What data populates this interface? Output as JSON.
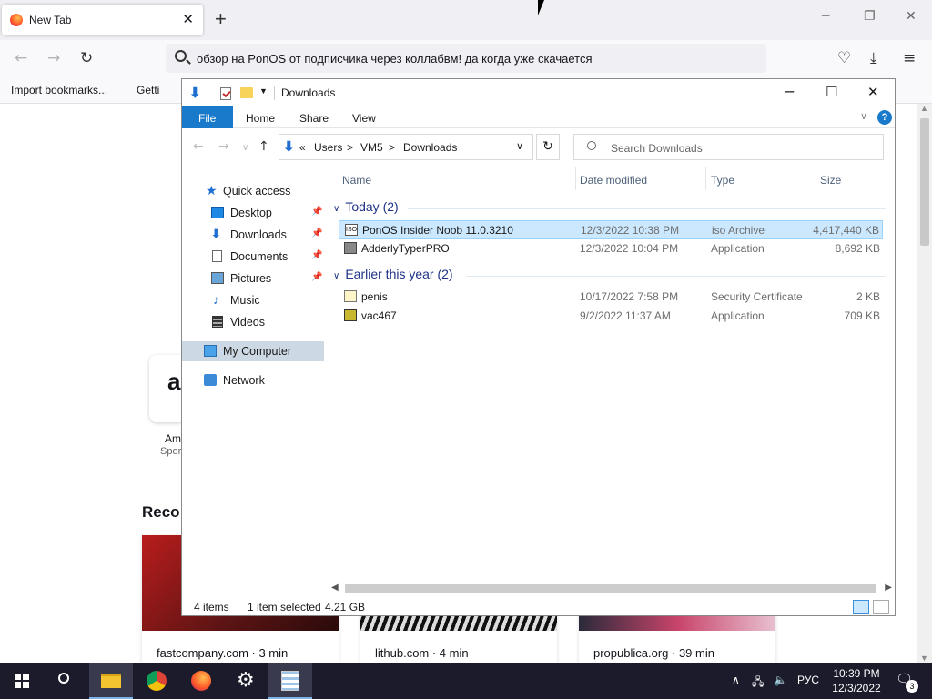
{
  "browser": {
    "tab_title": "New Tab",
    "new_tab": "+",
    "win_min": "─",
    "win_max": "❐",
    "win_close": "✕",
    "back": "←",
    "forward": "→",
    "reload": "↻",
    "url": "обзор на PonOS от подписчика через коллабвм! да когда уже скачается",
    "bookmarks": [
      "Import bookmarks...",
      "Getti"
    ],
    "amazon_title": "Am",
    "amazon_sub": "Spor",
    "recent_heading": "Reco",
    "recent_cards": [
      {
        "source": "fastcompany.com · 3 min"
      },
      {
        "source": "lithub.com · 4 min"
      },
      {
        "source": "propublica.org · 39 min"
      }
    ]
  },
  "explorer": {
    "title": "Downloads",
    "ribbon_tabs": [
      "File",
      "Home",
      "Share",
      "View"
    ],
    "help": "?",
    "breadcrumb": [
      "«",
      "Users",
      ">",
      "VM5",
      ">",
      "Downloads"
    ],
    "search_placeholder": "Search Downloads",
    "nav": {
      "quick_access": "Quick access",
      "desktop": "Desktop",
      "downloads": "Downloads",
      "documents": "Documents",
      "pictures": "Pictures",
      "music": "Music",
      "videos": "Videos",
      "my_computer": "My Computer",
      "network": "Network"
    },
    "columns": [
      "Name",
      "Date modified",
      "Type",
      "Size"
    ],
    "groups": [
      {
        "label": "Today (2)",
        "files": [
          {
            "name": "PonOS Insider Noob 11.0.3210",
            "date": "12/3/2022 10:38 PM",
            "type": "iso Archive",
            "size": "4,417,440 KB"
          },
          {
            "name": "AdderlyTyperPRO",
            "date": "12/3/2022 10:04 PM",
            "type": "Application",
            "size": "8,692 KB"
          }
        ]
      },
      {
        "label": "Earlier this year (2)",
        "files": [
          {
            "name": "penis",
            "date": "10/17/2022 7:58 PM",
            "type": "Security Certificate",
            "size": "2 KB"
          },
          {
            "name": "vac467",
            "date": "9/2/2022 11:37 AM",
            "type": "Application",
            "size": "709 KB"
          }
        ]
      }
    ],
    "status": {
      "items": "4 items",
      "selected": "1 item selected",
      "size": "4.21 GB"
    }
  },
  "taskbar": {
    "lang": "РУС",
    "time": "10:39 PM",
    "date": "12/3/2022",
    "notifications": "3"
  }
}
